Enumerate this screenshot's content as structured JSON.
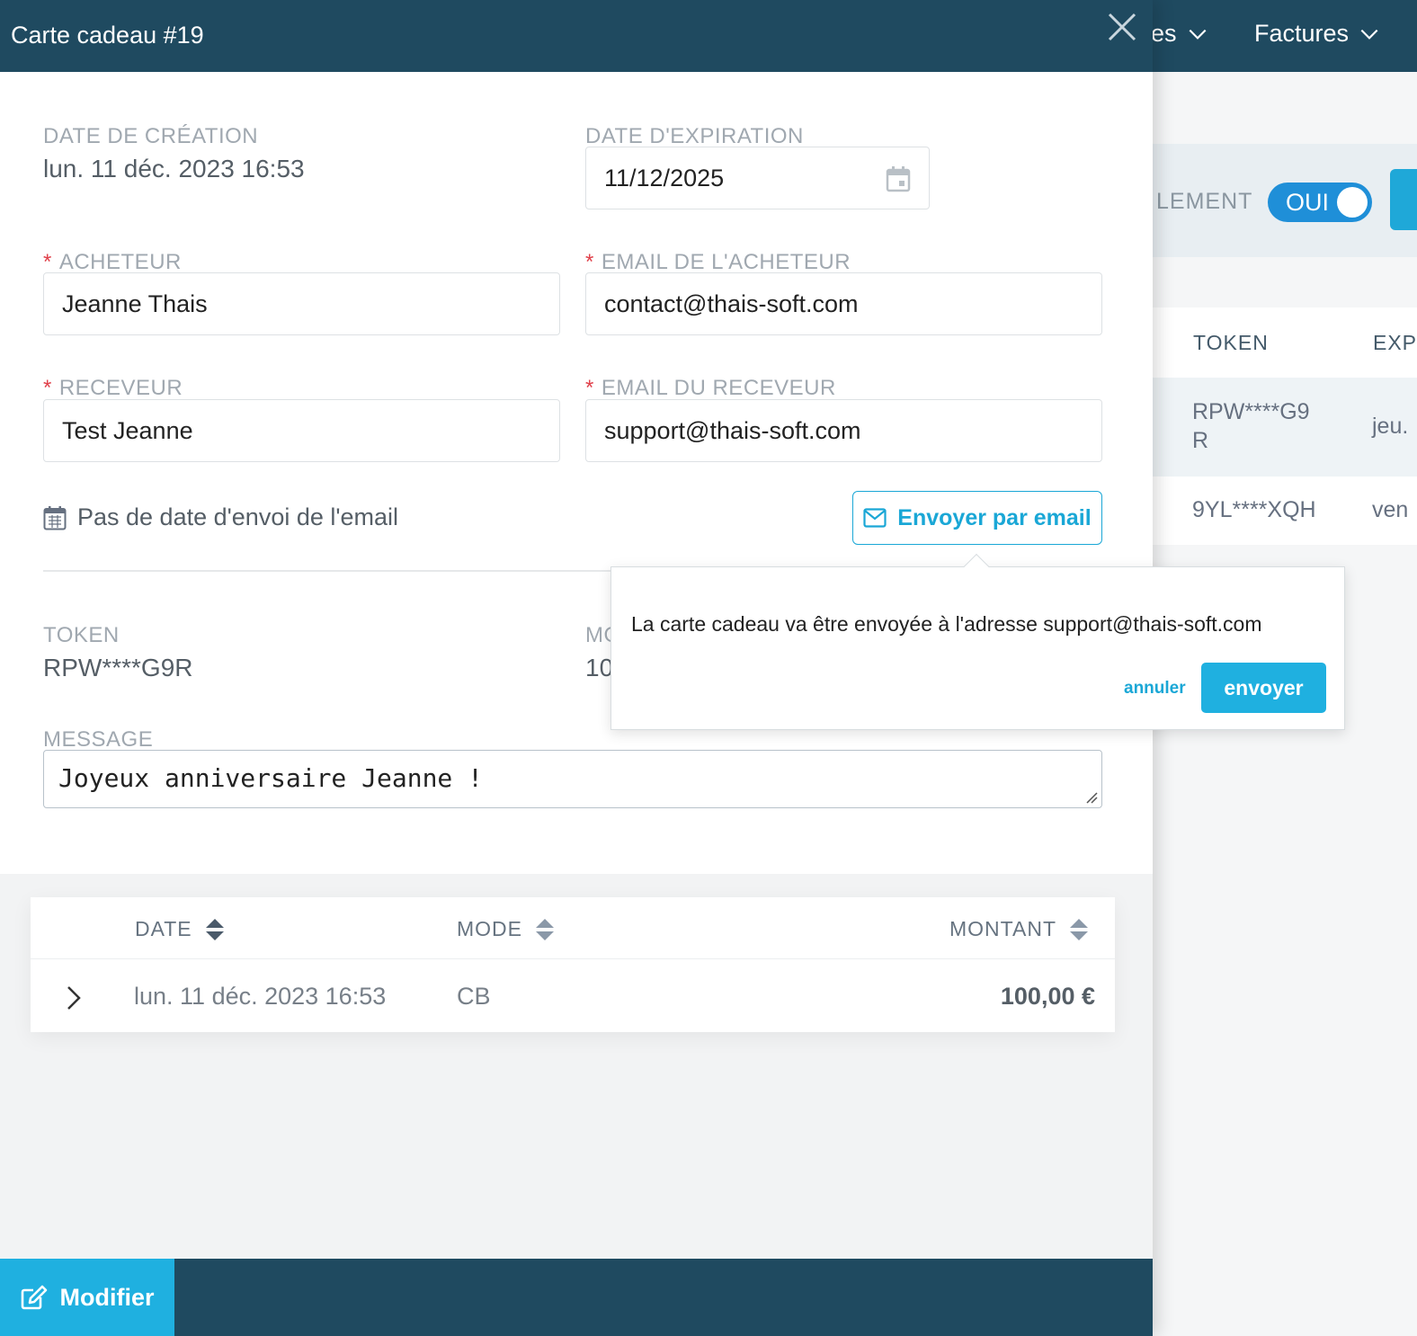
{
  "background": {
    "nav": {
      "item1": "es",
      "item2": "Factures"
    },
    "filter": {
      "label": "LEMENT",
      "toggle": "OUI"
    },
    "table": {
      "columns": [
        "TOKEN",
        "EXP"
      ],
      "rows": [
        {
          "token_line1": "RPW****G9",
          "token_line2": "R",
          "exp": "jeu."
        },
        {
          "token_line1": "9YL****XQH",
          "exp": "ven"
        }
      ]
    }
  },
  "modal": {
    "title": "Carte cadeau #19",
    "creation": {
      "label": "DATE DE CRÉATION",
      "value": "lun. 11 déc. 2023 16:53"
    },
    "expiration": {
      "label": "DATE D'EXPIRATION",
      "value": "11/12/2025"
    },
    "buyer": {
      "label": "ACHETEUR",
      "value": "Jeanne Thais"
    },
    "buyer_email": {
      "label": "EMAIL DE L'ACHETEUR",
      "value": "contact@thais-soft.com"
    },
    "receiver": {
      "label": "RECEVEUR",
      "value": "Test Jeanne"
    },
    "receiver_email": {
      "label": "EMAIL DU RECEVEUR",
      "value": "support@thais-soft.com"
    },
    "required_mark": "*",
    "send_note": "Pas de date d'envoi de l'email",
    "send_button": "Envoyer par email",
    "token": {
      "label": "TOKEN",
      "value": "RPW****G9R"
    },
    "amount_partial": {
      "label": "MO",
      "value": "10"
    },
    "message": {
      "label": "MESSAGE",
      "value": "Joyeux anniversaire Jeanne !"
    },
    "popover": {
      "message": "La carte cadeau va être envoyée à l'adresse support@thais-soft.com",
      "cancel": "annuler",
      "confirm": "envoyer"
    },
    "payments": {
      "columns": {
        "date": "DATE",
        "mode": "MODE",
        "amount": "MONTANT"
      },
      "rows": [
        {
          "date": "lun. 11 déc. 2023 16:53",
          "mode": "CB",
          "amount": "100,00 €"
        }
      ]
    },
    "edit_button": "Modifier"
  },
  "colors": {
    "header": "#1f4a60",
    "accent": "#1fb0e0",
    "required": "#e0404a",
    "toggle": "#1f8fd8"
  }
}
